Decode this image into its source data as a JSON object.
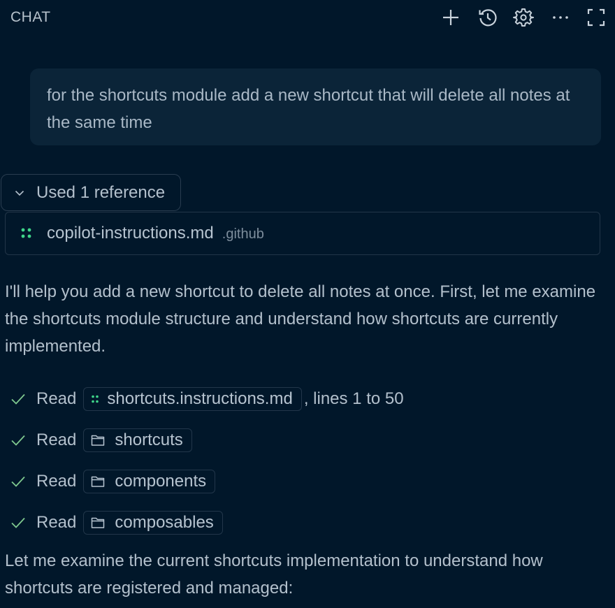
{
  "header": {
    "title": "CHAT",
    "icons": [
      "plus-icon",
      "history-icon",
      "gear-icon",
      "more-icon",
      "maximize-icon"
    ]
  },
  "user_message": {
    "text": "for the shortcuts module add a new shortcut that will delete all notes at the same time"
  },
  "references": {
    "toggle_label": "Used 1 reference",
    "file": {
      "name": "copilot-instructions.md",
      "dir": ".github"
    }
  },
  "response": {
    "intro": "I'll help you add a new shortcut to delete all notes at once. First, let me examine the shortcuts module structure and understand how shortcuts are currently implemented.",
    "reads": [
      {
        "label": "Read",
        "target": "shortcuts.instructions.md",
        "kind": "file",
        "suffix": ", lines 1 to 50"
      },
      {
        "label": "Read",
        "target": "shortcuts",
        "kind": "folder",
        "suffix": ""
      },
      {
        "label": "Read",
        "target": "components",
        "kind": "folder",
        "suffix": ""
      },
      {
        "label": "Read",
        "target": "composables",
        "kind": "folder",
        "suffix": ""
      }
    ],
    "followup": "Let me examine the current shortcuts implementation to understand how shortcuts are registered and managed:"
  },
  "colors": {
    "background": "#01172a",
    "bubble": "#0b2438",
    "accent_green": "#3fd68a",
    "check_green": "#7fc98f",
    "text": "#b3c0cc"
  }
}
